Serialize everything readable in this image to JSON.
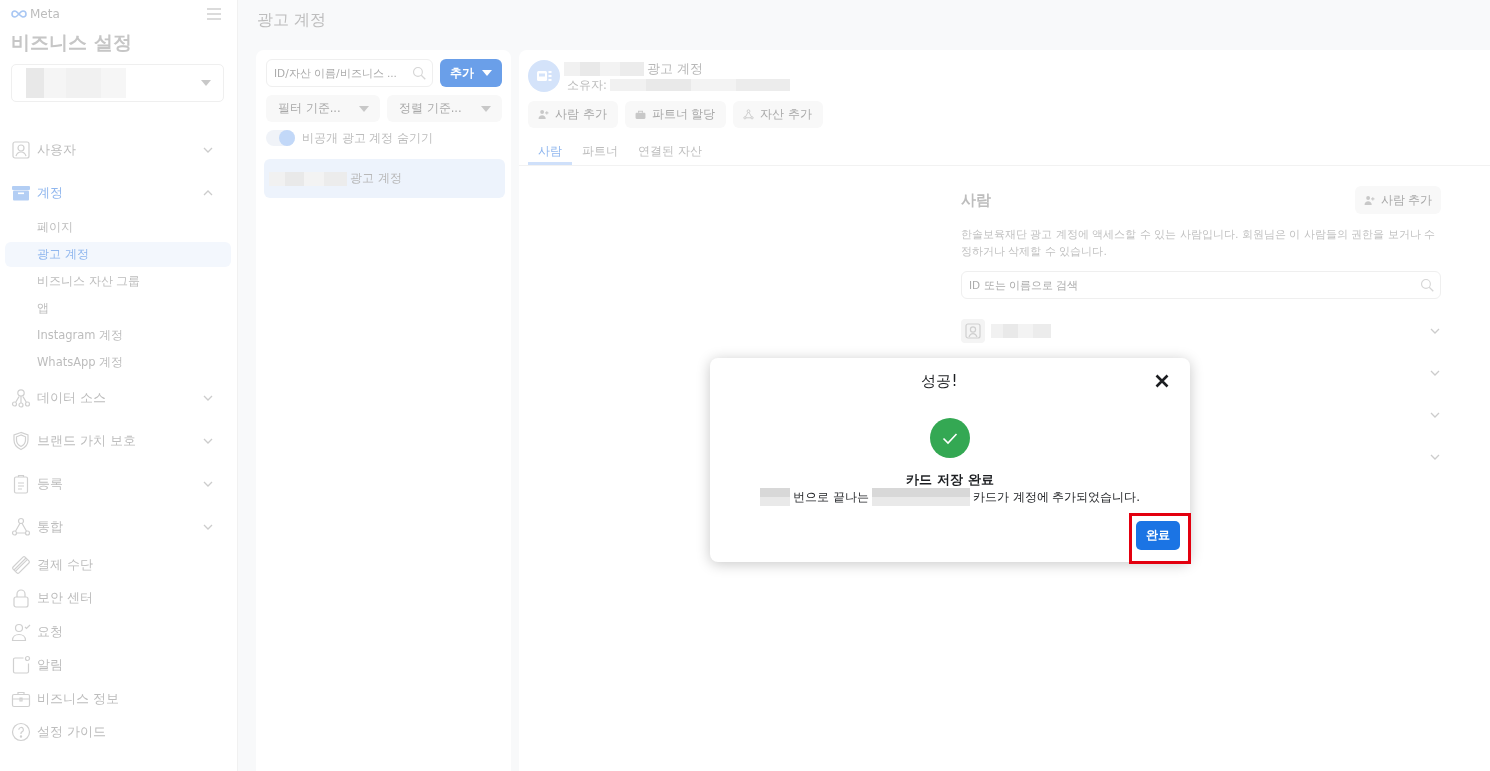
{
  "sidebar": {
    "brand": "Meta",
    "title": "비즈니스 설정",
    "business_selector": {
      "value": [
        {
          "kind": "redacted"
        }
      ]
    },
    "nav": [
      {
        "kind": "group",
        "label": "사용자",
        "selected": false,
        "expanded": false
      },
      {
        "kind": "group",
        "label": "계정",
        "selected": true,
        "expanded": true,
        "children": [
          {
            "label": "페이지",
            "selected": false
          },
          {
            "label": "광고 계정",
            "selected": true
          },
          {
            "label": "비즈니스 자산 그룹",
            "selected": false
          },
          {
            "label": "앱",
            "selected": false
          },
          {
            "label": "Instagram 계정",
            "selected": false
          },
          {
            "label": "WhatsApp 계정",
            "selected": false
          }
        ]
      },
      {
        "kind": "group",
        "label": "데이터 소스",
        "selected": false,
        "expanded": false
      },
      {
        "kind": "group",
        "label": "브랜드 가치 보호",
        "selected": false,
        "expanded": false
      },
      {
        "kind": "group",
        "label": "등록",
        "selected": false,
        "expanded": false
      },
      {
        "kind": "group",
        "label": "통합",
        "selected": false,
        "expanded": false
      },
      {
        "kind": "link",
        "label": "결제 수단",
        "selected": false
      },
      {
        "kind": "link",
        "label": "보안 센터",
        "selected": false
      },
      {
        "kind": "link",
        "label": "요청",
        "selected": false
      },
      {
        "kind": "link",
        "label": "알림",
        "selected": false
      },
      {
        "kind": "link",
        "label": "비즈니스 정보",
        "selected": false
      },
      {
        "kind": "link",
        "label": "설정 가이드",
        "selected": false
      }
    ]
  },
  "page_title": "광고 계정",
  "asset_list": {
    "search": {
      "placeholder": "ID/자산 이름/비즈니스 ..."
    },
    "add_button": "추가",
    "filters": [
      {
        "label": "필터 기준..."
      },
      {
        "label": "정렬 기준..."
      }
    ],
    "toggle": {
      "label": "비공개 광고 계정 숨기기",
      "on": true
    },
    "items": [
      {
        "name": [
          {
            "kind": "redacted"
          },
          {
            "kind": "text",
            "text": "광고 계정"
          }
        ],
        "selected": true
      }
    ]
  },
  "detail": {
    "account": {
      "title": [
        {
          "kind": "redacted"
        },
        {
          "kind": "text",
          "text": "광고 계정"
        }
      ],
      "owner": [
        {
          "kind": "text",
          "text": "소유자:"
        },
        {
          "kind": "redacted"
        }
      ]
    },
    "actions": [
      {
        "label": "사람 추가"
      },
      {
        "label": "파트너 할당"
      },
      {
        "label": "자산 추가"
      }
    ],
    "tabs": [
      {
        "label": "사람",
        "selected": true
      },
      {
        "label": "파트너",
        "selected": false
      },
      {
        "label": "연결된 자산",
        "selected": false
      }
    ],
    "people": {
      "title": "사람",
      "add_button": "사람 추가",
      "description": "한솔보육재단 광고 계정에 액세스할 수 있는 사람입니다. 회원님은 이 사람들의 권한을 보거나 수정하거나 삭제할 수 있습니다.",
      "search": {
        "placeholder": "ID 또는 이름으로 검색"
      },
      "rows": [
        {
          "name": [
            {
              "kind": "redacted"
            }
          ],
          "expanded": false
        },
        {
          "expanded": false
        },
        {
          "expanded": false
        },
        {
          "expanded": false
        }
      ]
    }
  },
  "modal": {
    "title": "성공!",
    "heading": "카드 저장 완료",
    "message": [
      {
        "kind": "redacted"
      },
      {
        "kind": "text",
        "text": "번으로 끝나는"
      },
      {
        "kind": "redacted"
      },
      {
        "kind": "text",
        "text": "카드가 계정에 추가되었습니다."
      }
    ],
    "confirm_button": {
      "label": "완료",
      "highlighted": true
    }
  }
}
